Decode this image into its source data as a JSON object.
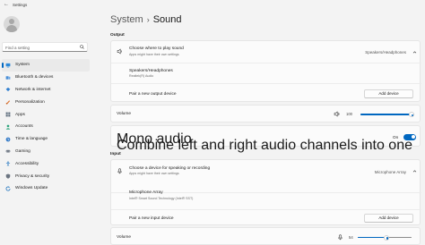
{
  "window": {
    "title": "Settings",
    "back_glyph": "←"
  },
  "sidebar": {
    "search_placeholder": "Find a setting",
    "items": [
      {
        "label": "System",
        "icon": "system-icon",
        "active": true
      },
      {
        "label": "Bluetooth & devices",
        "icon": "bluetooth-icon"
      },
      {
        "label": "Network & internet",
        "icon": "network-icon"
      },
      {
        "label": "Personalization",
        "icon": "personalization-icon"
      },
      {
        "label": "Apps",
        "icon": "apps-icon"
      },
      {
        "label": "Accounts",
        "icon": "accounts-icon"
      },
      {
        "label": "Time & language",
        "icon": "time-language-icon"
      },
      {
        "label": "Gaming",
        "icon": "gaming-icon"
      },
      {
        "label": "Accessibility",
        "icon": "accessibility-icon"
      },
      {
        "label": "Privacy & security",
        "icon": "privacy-security-icon"
      },
      {
        "label": "Windows Update",
        "icon": "windows-update-icon"
      }
    ]
  },
  "header": {
    "crumb": "System",
    "separator": "›",
    "current": "Sound"
  },
  "output": {
    "section_label": "Output",
    "choose": {
      "title": "Choose where to play sound",
      "subtitle": "Apps might have their own settings",
      "value": "Speakers/Headphones"
    },
    "device": {
      "title": "Speakers/Headphones",
      "subtitle": "Realtek(R) Audio"
    },
    "pair": {
      "title": "Pair a new output device",
      "button": "Add device"
    },
    "volume": {
      "label": "Volume",
      "value": "100",
      "level": 1.0
    },
    "mono": {
      "title": "Mono audio",
      "subtitle": "Combine left and right audio channels into one",
      "state": "On",
      "enabled": true
    }
  },
  "input": {
    "section_label": "Input",
    "choose": {
      "title": "Choose a device for speaking or recording",
      "subtitle": "Apps might have their own settings",
      "value": "Microphone Array"
    },
    "device": {
      "title": "Microphone Array",
      "subtitle": "Intel® Smart Sound Technology (Intel® SST)"
    },
    "pair": {
      "title": "Pair a new input device",
      "button": "Add device"
    },
    "volume": {
      "label": "Volume",
      "value": "54",
      "level": 0.54
    }
  },
  "colors": {
    "accent": "#0067c0",
    "background": "#f3f3f3",
    "card": "#fbfbfb"
  }
}
